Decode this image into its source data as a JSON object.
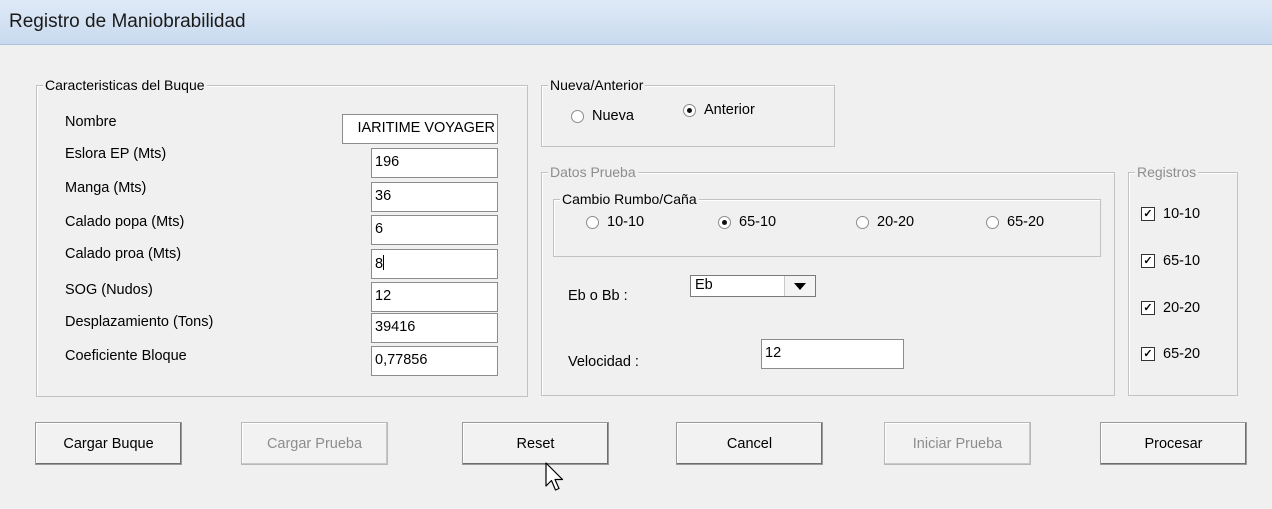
{
  "window": {
    "title": "Registro de Maniobrabilidad"
  },
  "ship": {
    "legend": "Caracteristicas del Buque",
    "fields": [
      {
        "label": "Nombre",
        "value": "IARITIME VOYAGER"
      },
      {
        "label": "Eslora EP (Mts)",
        "value": "196"
      },
      {
        "label": "Manga (Mts)",
        "value": "36"
      },
      {
        "label": "Calado popa (Mts)",
        "value": "6"
      },
      {
        "label": "Calado proa (Mts)",
        "value": "8"
      },
      {
        "label": "SOG (Nudos)",
        "value": "12"
      },
      {
        "label": "Desplazamiento (Tons)",
        "value": "39416"
      },
      {
        "label": "Coeficiente Bloque",
        "value": "0,77856"
      }
    ]
  },
  "mode": {
    "legend": "Nueva/Anterior",
    "options": [
      {
        "label": "Nueva",
        "checked": false
      },
      {
        "label": "Anterior",
        "checked": true
      }
    ]
  },
  "test": {
    "legend": "Datos Prueba",
    "rumbo": {
      "legend": "Cambio Rumbo/Caña",
      "options": [
        {
          "label": "10-10",
          "checked": false
        },
        {
          "label": "65-10",
          "checked": true
        },
        {
          "label": "20-20",
          "checked": false
        },
        {
          "label": "65-20",
          "checked": false
        }
      ]
    },
    "eb_label": "Eb o Bb :",
    "eb_value": "Eb",
    "vel_label": "Velocidad :",
    "vel_value": "12"
  },
  "registros": {
    "legend": "Registros",
    "items": [
      {
        "label": "10-10",
        "checked": true
      },
      {
        "label": "65-10",
        "checked": true
      },
      {
        "label": "20-20",
        "checked": true
      },
      {
        "label": "65-20",
        "checked": true
      }
    ]
  },
  "buttons": {
    "cargar_buque": "Cargar Buque",
    "cargar_prueba": "Cargar Prueba",
    "reset": "Reset",
    "cancel": "Cancel",
    "iniciar_prueba": "Iniciar Prueba",
    "procesar": "Procesar"
  }
}
